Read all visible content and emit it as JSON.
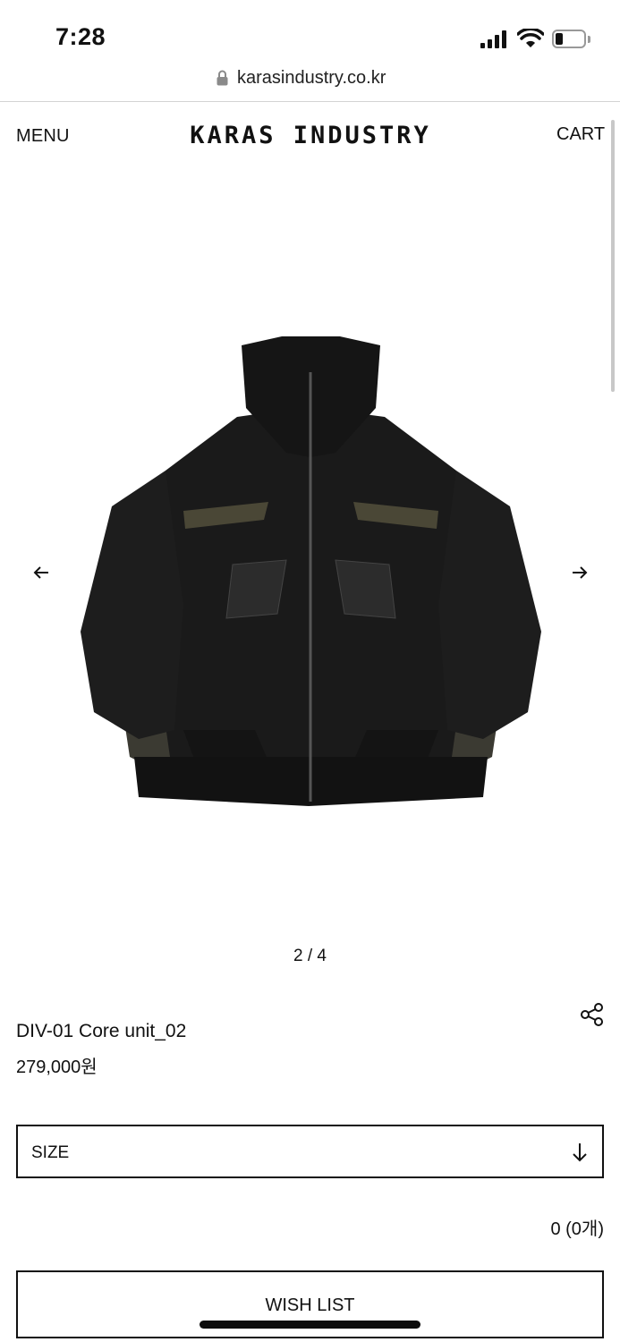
{
  "status_bar": {
    "time": "7:28"
  },
  "browser": {
    "url": "karasindustry.co.kr"
  },
  "header": {
    "menu_label": "MENU",
    "logo_text": "KARAS INDUSTRY",
    "cart_label": "CART"
  },
  "gallery": {
    "image_alt": "black zip-up jacket with olive panels",
    "pager": "2 / 4"
  },
  "product": {
    "name": "DIV-01 Core unit_02",
    "price": "279,000원"
  },
  "options": {
    "size_label": "SIZE"
  },
  "summary": {
    "total": "0 (0개)"
  },
  "actions": {
    "wish_list_label": "WISH LIST"
  },
  "icons": {
    "lock": "lock-icon",
    "prev": "arrow-left-icon",
    "next": "arrow-right-icon",
    "share": "share-icon",
    "size_dropdown": "arrow-down-icon"
  }
}
